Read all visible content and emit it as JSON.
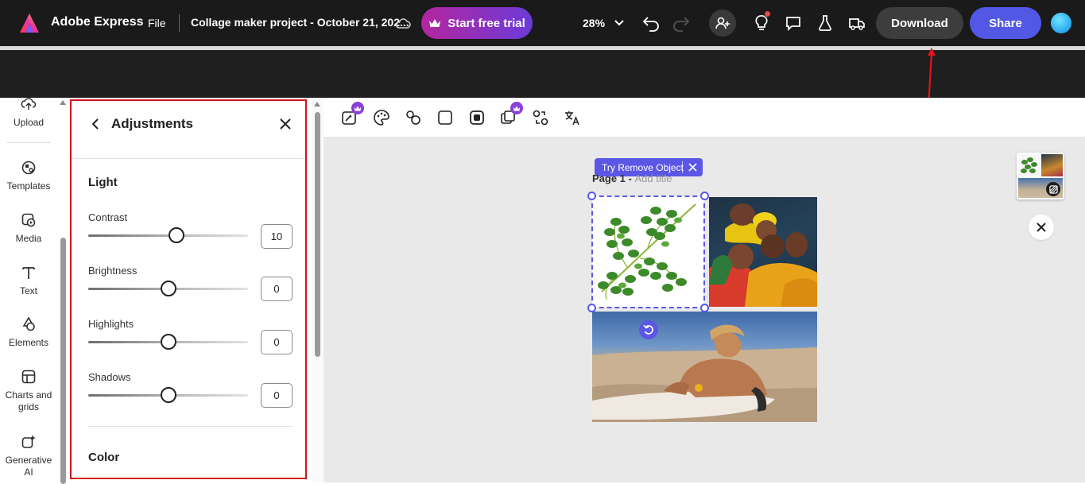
{
  "app": {
    "name": "Adobe Express",
    "file_menu": "File",
    "project_title": "Collage maker project - October 21, 202...",
    "trial_button": "Start free trial",
    "zoom": "28%",
    "download_button": "Download",
    "share_button": "Share",
    "colors": {
      "topbar": "#1a1a1a",
      "accent": "#5258e4",
      "trial_gradient_start": "#b3269f",
      "trial_gradient_end": "#6b3bd8",
      "highlight_border": "#d3151c",
      "notification": "#e8484c"
    },
    "icons": [
      "adobe-express-logo",
      "cloud-icon",
      "crown-icon",
      "chevron-down-icon",
      "undo-icon",
      "redo-icon",
      "invite-icon",
      "lightbulb-icon",
      "comment-icon",
      "flask-icon",
      "truck-icon"
    ]
  },
  "sidebar": {
    "items": [
      {
        "label": "Upload",
        "icon": "upload-icon"
      },
      {
        "label": "Templates",
        "icon": "templates-icon"
      },
      {
        "label": "Media",
        "icon": "media-icon"
      },
      {
        "label": "Text",
        "icon": "text-icon"
      },
      {
        "label": "Elements",
        "icon": "elements-icon"
      },
      {
        "label": "Charts and grids",
        "icon": "charts-icon"
      },
      {
        "label": "Generative AI",
        "icon": "generative-ai-icon"
      }
    ]
  },
  "panel": {
    "title": "Adjustments",
    "section_light": "Light",
    "section_color": "Color",
    "adjustments": [
      {
        "label": "Contrast",
        "value": "10",
        "slider_fraction": 0.55
      },
      {
        "label": "Brightness",
        "value": "0",
        "slider_fraction": 0.5
      },
      {
        "label": "Highlights",
        "value": "0",
        "slider_fraction": 0.5
      },
      {
        "label": "Shadows",
        "value": "0",
        "slider_fraction": 0.5
      }
    ]
  },
  "canvas": {
    "try_remove_object": "Try Remove Object",
    "page_label": "Page 1 - ",
    "page_title_placeholder": "Add title",
    "toolbar_icons": [
      "magic-icon",
      "palette-icon",
      "shapes-icon",
      "square-icon",
      "mask-icon",
      "layers-icon",
      "swap-icon",
      "translate-icon"
    ]
  }
}
